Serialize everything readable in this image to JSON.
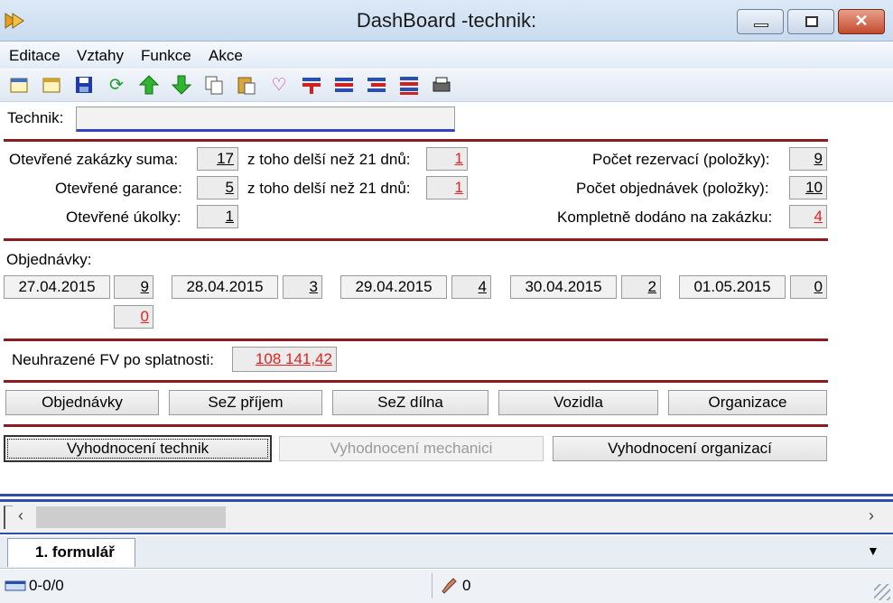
{
  "window": {
    "title": "DashBoard -technik:"
  },
  "menu": [
    "Editace",
    "Vztahy",
    "Funkce",
    "Akce"
  ],
  "toolbar_icons": [
    "new-icon",
    "new-copy-icon",
    "save-icon",
    "refresh-icon",
    "arrow-up-icon",
    "arrow-down-icon",
    "copy-icon",
    "paste-icon",
    "hearts-icon",
    "filter-add-icon",
    "filter-icon",
    "filter-remove-icon",
    "filter-list-icon",
    "print-icon"
  ],
  "technik": {
    "label": "Technik:",
    "value": ""
  },
  "stats": {
    "otevrene_zakazky": {
      "label": "Otevřené zakázky suma:",
      "value": "17",
      "older_label": "z toho delší než 21 dnů:",
      "older_value": "1"
    },
    "otevrene_garance": {
      "label": "Otevřené garance:",
      "value": "5",
      "older_label": "z toho delší než 21 dnů:",
      "older_value": "1"
    },
    "otevrene_ukolky": {
      "label": "Otevřené úkolky:",
      "value": "1"
    },
    "pocet_rezervaci": {
      "label": "Počet rezervací (položky):",
      "value": "9"
    },
    "pocet_objednavek": {
      "label": "Počet objednávek (položky):",
      "value": "10"
    },
    "kompletne_dodano": {
      "label": "Kompletně dodáno na zakázku:",
      "value": "4"
    }
  },
  "objednavky": {
    "label": "Objednávky:",
    "dates": [
      {
        "date": "27.04.2015",
        "count": "9"
      },
      {
        "date": "28.04.2015",
        "count": "3"
      },
      {
        "date": "29.04.2015",
        "count": "4"
      },
      {
        "date": "30.04.2015",
        "count": "2"
      },
      {
        "date": "01.05.2015",
        "count": "0"
      }
    ],
    "extra_count": "0"
  },
  "neuhrazene": {
    "label": "Neuhrazené FV po splatnosti:",
    "value": "108 141,42"
  },
  "buttons_row1": [
    "Objednávky",
    "SeZ příjem",
    "SeZ dílna",
    "Vozidla",
    "Organizace"
  ],
  "buttons_row2": [
    "Vyhodnocení technik",
    "Vyhodnocení mechanici",
    "Vyhodnocení organizací"
  ],
  "tabs": {
    "active": "1. formulář"
  },
  "status": {
    "record": "0-0/0",
    "count": "0"
  }
}
